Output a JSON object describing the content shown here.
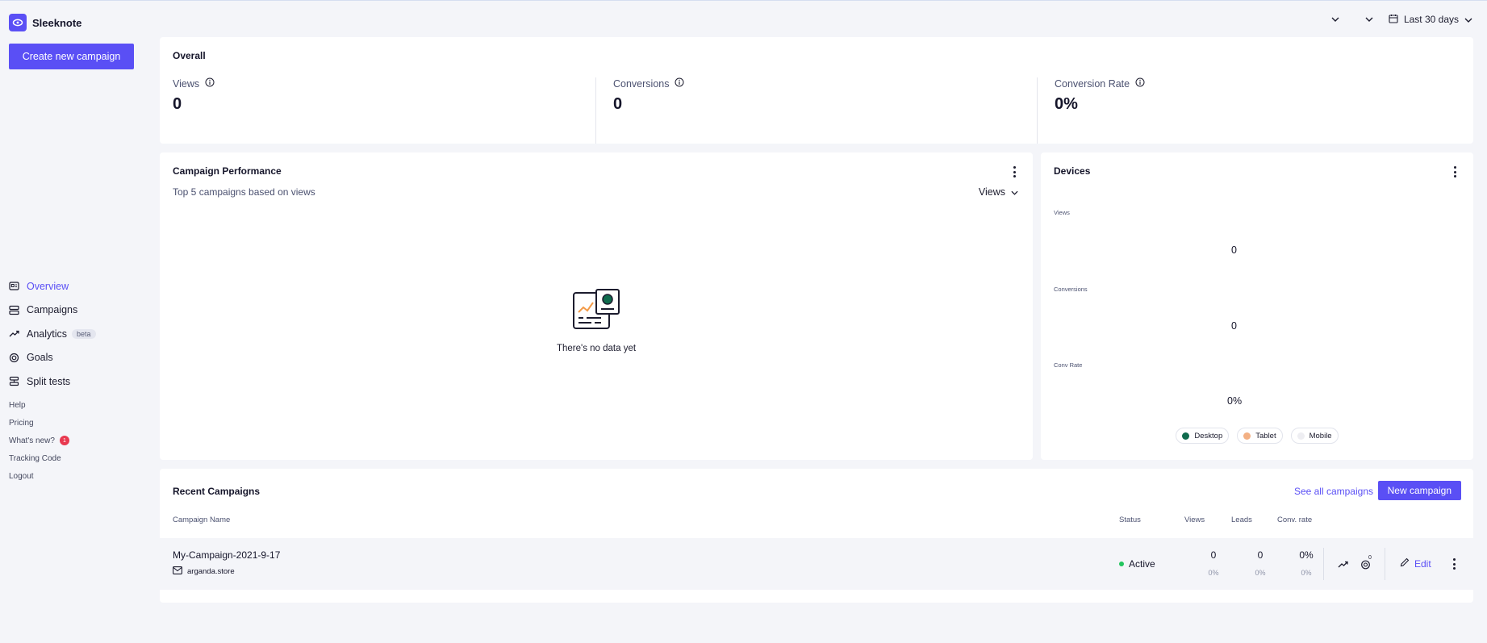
{
  "brand": {
    "name": "Sleeknote"
  },
  "sidebar": {
    "create_label": "Create new campaign",
    "nav": [
      {
        "label": "Overview",
        "icon": "overview-icon"
      },
      {
        "label": "Campaigns",
        "icon": "campaigns-icon"
      },
      {
        "label": "Analytics",
        "icon": "analytics-icon",
        "badge": "beta"
      },
      {
        "label": "Goals",
        "icon": "goals-icon"
      },
      {
        "label": "Split tests",
        "icon": "split-tests-icon"
      }
    ],
    "links": [
      {
        "label": "Help"
      },
      {
        "label": "Pricing"
      },
      {
        "label": "What's new?",
        "badge": "1"
      },
      {
        "label": "Tracking Code"
      },
      {
        "label": "Logout"
      }
    ]
  },
  "topbar": {
    "date_range": "Last 30 days"
  },
  "overall": {
    "title": "Overall",
    "stats": [
      {
        "label": "Views",
        "value": "0"
      },
      {
        "label": "Conversions",
        "value": "0"
      },
      {
        "label": "Conversion Rate",
        "value": "0%"
      }
    ]
  },
  "performance": {
    "title": "Campaign Performance",
    "subtitle": "Top 5 campaigns based on views",
    "metric": "Views",
    "empty_text": "There's no data yet"
  },
  "devices": {
    "title": "Devices",
    "rows": [
      {
        "label": "Views",
        "value": "0"
      },
      {
        "label": "Conversions",
        "value": "0"
      },
      {
        "label": "Conv Rate",
        "value": "0%"
      }
    ],
    "legend": [
      {
        "label": "Desktop",
        "color": "#0f6b4d"
      },
      {
        "label": "Tablet",
        "color": "#f3b083"
      },
      {
        "label": "Mobile",
        "color": "#eeeef2"
      }
    ]
  },
  "recent": {
    "title": "Recent Campaigns",
    "see_all": "See all campaigns",
    "new_label": "New campaign",
    "columns": {
      "name": "Campaign Name",
      "status": "Status",
      "views": "Views",
      "leads": "Leads",
      "conv": "Conv. rate"
    },
    "rows": [
      {
        "name": "My-Campaign-2021-9-17",
        "site": "arganda.store",
        "status": "Active",
        "views": "0",
        "views_pct": "0%",
        "leads": "0",
        "leads_pct": "0%",
        "conv": "0%",
        "conv_pct": "0%",
        "goals_count": "0",
        "edit_label": "Edit"
      }
    ]
  },
  "colors": {
    "accent": "#5a4ff5",
    "active": "#22c55e",
    "badge": "#e8384f"
  }
}
